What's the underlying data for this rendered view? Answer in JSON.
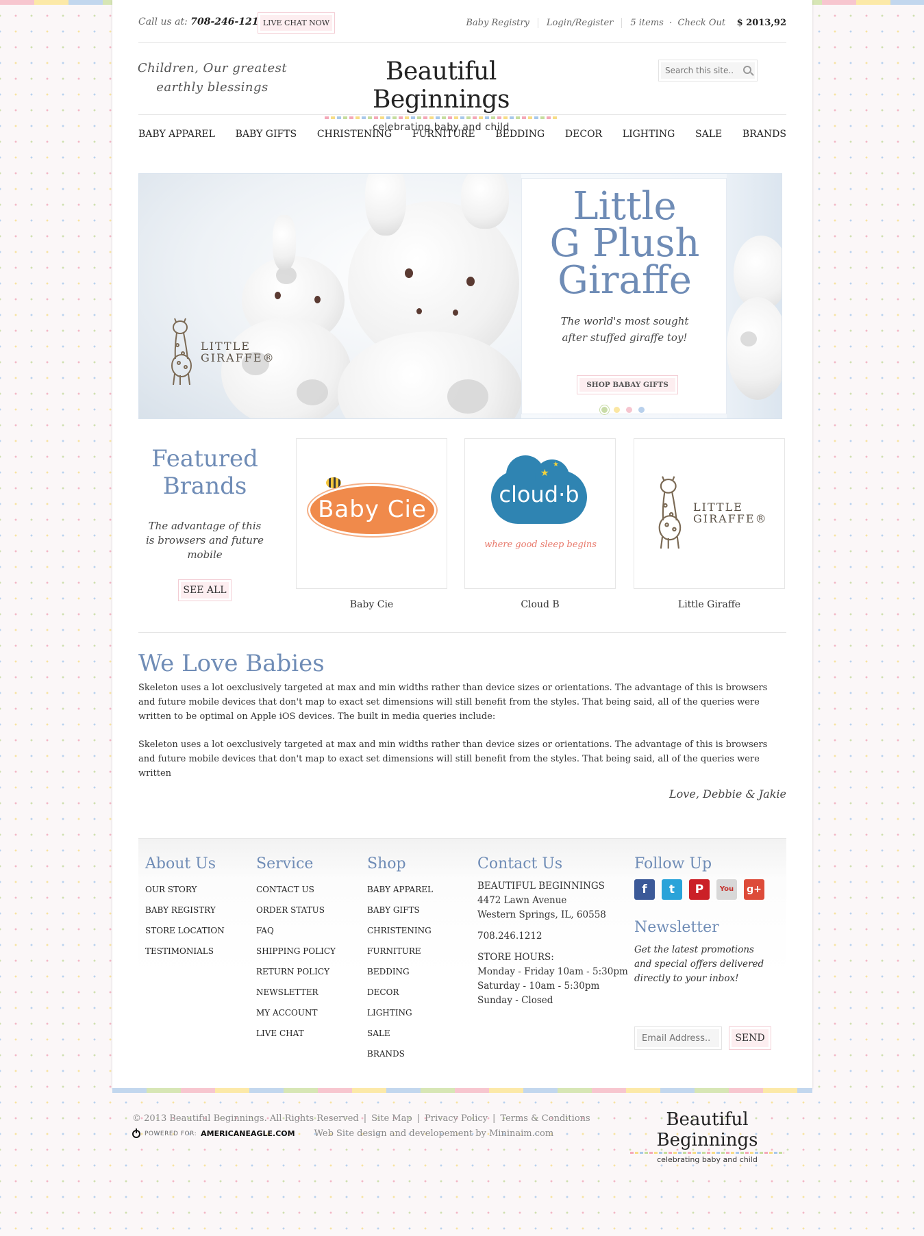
{
  "topbar": {
    "call_label": "Call us at:",
    "phone": "708-246-1212",
    "live_chat": "LIVE CHAT NOW",
    "baby_registry": "Baby Registry",
    "login": "Login/Register",
    "cart_items": "5 items",
    "checkout": "Check Out",
    "cart_total": "$ 2013,92"
  },
  "header": {
    "tagline": "Children, Our greatest earthly blessings",
    "logo_name": "Beautiful Beginnings",
    "logo_sub": "celebrating baby and child",
    "search_placeholder": "Search this site.."
  },
  "nav": [
    "BABY APPAREL",
    "BABY GIFTS",
    "CHRISTENING",
    "FURNITURE",
    "BEDDING",
    "DECOR",
    "LIGHTING",
    "SALE",
    "BRANDS"
  ],
  "hero": {
    "title_lines": [
      "Little",
      "G Plush",
      "Giraffe"
    ],
    "blurb": "The world's most sought after stuffed giraffe toy!",
    "button": "SHOP BABAY GIFTS",
    "badge_lines": [
      "LITTLE",
      "GIRAFFE®"
    ],
    "pager_colors": [
      "#c9dca8",
      "#fbe7a3",
      "#f6c5cf",
      "#b8d0ec"
    ]
  },
  "featured": {
    "title": "Featured Brands",
    "text": "The advantage of this is browsers and future mobile",
    "see_all": "SEE ALL",
    "brands": [
      {
        "name": "Baby Cie",
        "logo_text": "Baby Cie"
      },
      {
        "name": "Cloud B",
        "logo_text": "cloud·b",
        "tagline": "where good sleep begins"
      },
      {
        "name": "Little Giraffe",
        "logo_lines": [
          "LITTLE",
          "GIRAFFE®"
        ]
      }
    ]
  },
  "about": {
    "title": "We Love Babies",
    "para1": "Skeleton uses a lot oexclusively targeted at max and min widths rather than device sizes or orientations. The advantage of this is browsers and future mobile devices that don't map to exact set dimensions will still benefit from the styles. That being said, all of the queries were written to be optimal on Apple iOS devices. The built in media queries include:",
    "para2": "Skeleton uses a lot oexclusively targeted at max and min widths rather than device sizes or orientations. The advantage of this is browsers and future mobile devices that don't map to exact set dimensions will still benefit from the styles. That being said, all of the queries were written",
    "signature": "Love, Debbie & Jakie"
  },
  "footer": {
    "about": {
      "title": "About Us",
      "links": [
        "OUR STORY",
        "BABY REGISTRY",
        "STORE LOCATION",
        "TESTIMONIALS"
      ]
    },
    "service": {
      "title": "Service",
      "links": [
        "CONTACT US",
        "ORDER STATUS",
        "FAQ",
        "SHIPPING POLICY",
        "RETURN POLICY",
        "NEWSLETTER",
        "MY ACCOUNT",
        "LIVE CHAT"
      ]
    },
    "shop": {
      "title": "Shop",
      "links": [
        "BABY APPAREL",
        "BABY GIFTS",
        "CHRISTENING",
        "FURNITURE",
        "BEDDING",
        "DECOR",
        "LIGHTING",
        "SALE",
        "BRANDS"
      ]
    },
    "contact": {
      "title": "Contact Us",
      "company": "BEAUTIFUL BEGINNINGS",
      "address1": "4472 Lawn Avenue",
      "address2": "Western Springs, IL, 60558",
      "phone": "708.246.1212",
      "hours_title": "STORE HOURS:",
      "hours": [
        "Monday - Friday 10am - 5:30pm",
        "Saturday - 10am - 5:30pm",
        "Sunday - Closed"
      ]
    },
    "follow": {
      "title": "Follow Up",
      "social": [
        {
          "name": "facebook",
          "glyph": "f",
          "color": "#3b5998"
        },
        {
          "name": "twitter",
          "glyph": "t",
          "color": "#2aa3d9"
        },
        {
          "name": "pinterest",
          "glyph": "P",
          "color": "#cb2027"
        },
        {
          "name": "youtube",
          "glyph": "You",
          "color": "#d8d8d8"
        },
        {
          "name": "google-plus",
          "glyph": "g+",
          "color": "#dd4b39"
        }
      ]
    },
    "newsletter": {
      "title": "Newsletter",
      "text": "Get the latest promotions and special offers delivered directly to your inbox!",
      "placeholder": "Email Address..",
      "send": "SEND"
    }
  },
  "bottom": {
    "copyright": "© 2013 Beautiful Beginnings. All Rights Reserved",
    "site_map": "Site Map",
    "privacy": "Privacy Policy",
    "terms": "Terms & Conditions",
    "powered_label": "POWERED FOR:",
    "powered_by": "AMERICANEAGLE.COM",
    "credit": "Web Site design and developement by Mininaim.com",
    "logo_name": "Beautiful Beginnings",
    "logo_sub": "celebrating baby and child"
  }
}
